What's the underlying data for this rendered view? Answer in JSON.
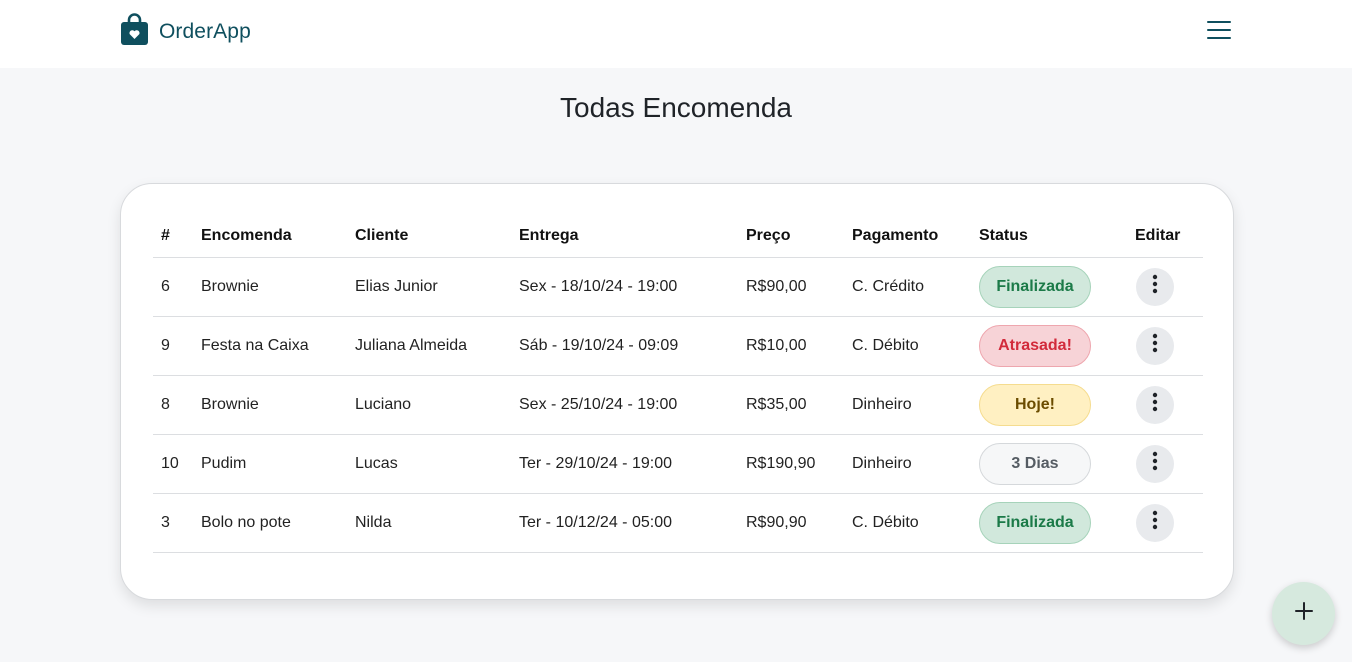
{
  "app": {
    "brand": "OrderApp"
  },
  "page": {
    "title": "Todas Encomenda"
  },
  "table": {
    "headers": {
      "id": "#",
      "order": "Encomenda",
      "client": "Cliente",
      "delivery": "Entrega",
      "price": "Preço",
      "payment": "Pagamento",
      "status": "Status",
      "edit": "Editar"
    },
    "rows": [
      {
        "id": "6",
        "order": "Brownie",
        "client": "Elias Junior",
        "delivery": "Sex - 18/10/24 - 19:00",
        "price": "R$90,00",
        "payment": "C. Crédito",
        "status": "Finalizada",
        "status_kind": "done"
      },
      {
        "id": "9",
        "order": "Festa na Caixa",
        "client": "Juliana Almeida",
        "delivery": "Sáb - 19/10/24 - 09:09",
        "price": "R$10,00",
        "payment": "C. Débito",
        "status": "Atrasada!",
        "status_kind": "late"
      },
      {
        "id": "8",
        "order": "Brownie",
        "client": "Luciano",
        "delivery": "Sex - 25/10/24 - 19:00",
        "price": "R$35,00",
        "payment": "Dinheiro",
        "status": "Hoje!",
        "status_kind": "today"
      },
      {
        "id": "10",
        "order": "Pudim",
        "client": "Lucas",
        "delivery": "Ter - 29/10/24 - 19:00",
        "price": "R$190,90",
        "payment": "Dinheiro",
        "status": "3 Dias",
        "status_kind": "days"
      },
      {
        "id": "3",
        "order": "Bolo no pote",
        "client": "Nilda",
        "delivery": "Ter - 10/12/24 - 05:00",
        "price": "R$90,90",
        "payment": "C. Débito",
        "status": "Finalizada",
        "status_kind": "done"
      }
    ]
  },
  "icons": {
    "brand": "shopping-bag-heart-icon",
    "menu": "hamburger-menu-icon",
    "edit": "vertical-dots-icon",
    "add": "plus-icon"
  },
  "colors": {
    "brand": "#0f4f5e",
    "status_done": "#1b7a48",
    "status_late": "#d22a3b",
    "status_today": "#6b4c00",
    "status_days": "#555c63"
  }
}
